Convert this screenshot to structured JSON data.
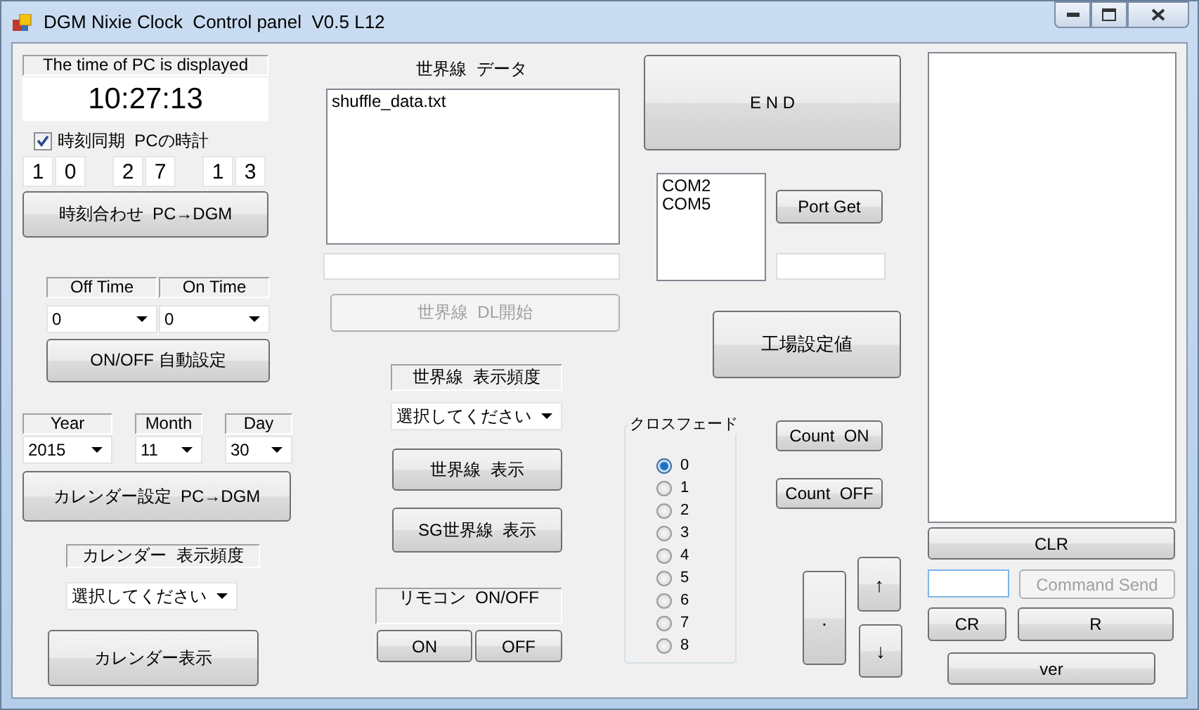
{
  "window": {
    "title": "DGM Nixie Clock  Control panel  V0.5 L12"
  },
  "pc_time": {
    "caption": "The time of PC is displayed",
    "time": "10:27:13"
  },
  "sync": {
    "label": "時刻同期  PCの時計",
    "checked": true
  },
  "digits": [
    [
      "1",
      "0"
    ],
    [
      "2",
      "7"
    ],
    [
      "1",
      "3"
    ]
  ],
  "set_time_button": "時刻合わせ  PC→DGM",
  "onoff": {
    "labels": [
      "Off Time",
      "On Time"
    ],
    "values": [
      "0",
      "0"
    ],
    "button": "ON/OFF 自動設定"
  },
  "calendar": {
    "fields": [
      {
        "label": "Year",
        "value": "2015"
      },
      {
        "label": "Month",
        "value": "11"
      },
      {
        "label": "Day",
        "value": "30"
      }
    ],
    "button": "カレンダー設定  PC→DGM",
    "freq_label": "カレンダー  表示頻度",
    "freq_value": "選択してください",
    "show_button": "カレンダー表示"
  },
  "worldline": {
    "caption": "世界線  データ",
    "files": [
      "shuffle_data.txt"
    ],
    "dl_button": {
      "label": "世界線  DL開始",
      "disabled": true
    },
    "freq_label": "世界線  表示頻度",
    "freq_value": "選択してください",
    "buttons": [
      "世界線  表示",
      "SG世界線  表示"
    ]
  },
  "remote": {
    "label": "リモコン  ON/OFF",
    "buttons": [
      "ON",
      "OFF"
    ]
  },
  "end_button": "E N D",
  "ports": {
    "items": [
      "COM2",
      "COM5"
    ],
    "button": "Port Get"
  },
  "factory_button": "工場設定値",
  "crossfade": {
    "title": "クロスフェード",
    "options": [
      {
        "label": "0",
        "selected": true
      },
      {
        "label": "1",
        "selected": false
      },
      {
        "label": "2",
        "selected": false
      },
      {
        "label": "3",
        "selected": false
      },
      {
        "label": "4",
        "selected": false
      },
      {
        "label": "5",
        "selected": false
      },
      {
        "label": "6",
        "selected": false
      },
      {
        "label": "7",
        "selected": false
      },
      {
        "label": "8",
        "selected": false
      }
    ]
  },
  "count_buttons": [
    "Count  ON",
    "Count  OFF"
  ],
  "keys": {
    "dot": ".",
    "up": "↑",
    "down": "↓"
  },
  "console": {
    "clear": "CLR",
    "send": {
      "label": "Command Send",
      "disabled": true
    },
    "cr": "CR",
    "r": "R",
    "ver": "ver"
  }
}
